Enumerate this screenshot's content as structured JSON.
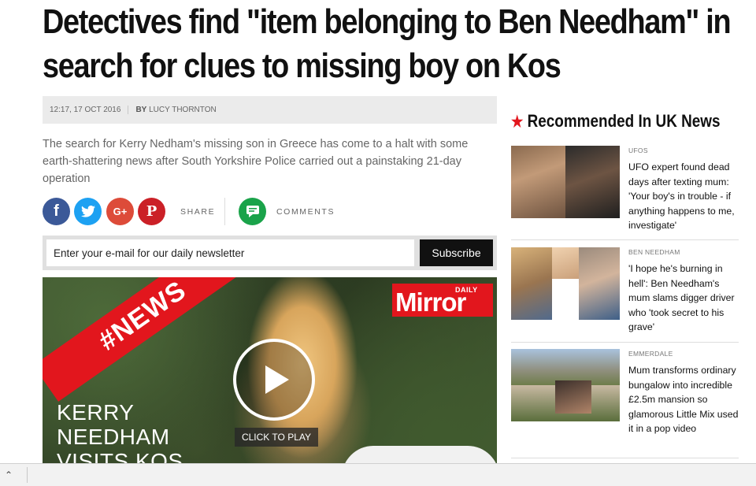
{
  "article": {
    "headline": "Detectives find \"item belonging to Ben Needham\" in search for clues to missing boy on Kos",
    "date": "12:17, 17 OCT 2016",
    "by_prefix": "BY",
    "author": "LUCY THORNTON",
    "standfirst": "The search for Kerry Nedham's missing son in Greece has come to a halt with some earth-shattering news after South Yorkshire Police carried out a painstaking 21-day operation"
  },
  "share": {
    "facebook_glyph": "f",
    "twitter_glyph": "t",
    "googleplus_glyph": "G+",
    "pinterest_glyph": "P",
    "share_label": "SHARE",
    "comments_label": "COMMENTS"
  },
  "newsletter": {
    "placeholder": "Enter your e-mail for our daily newsletter",
    "button": "Subscribe"
  },
  "video": {
    "ribbon": "#NEWS",
    "logo_daily": "DAILY",
    "logo_mirror": "Mirror",
    "caption_line1": "KERRY",
    "caption_line2": "NEEDHAM",
    "caption_line3": "VISITS KOS",
    "click_to_play": "CLICK TO PLAY"
  },
  "sidebar": {
    "title": "Recommended In UK News",
    "items": [
      {
        "category": "UFOS",
        "text": "UFO expert found dead days after texting mum: 'Your boy's in trouble - if anything happens to me, investigate'"
      },
      {
        "category": "BEN NEEDHAM",
        "text": "'I hope he's burning in hell': Ben Needham's mum slams digger driver who 'took secret to his grave'"
      },
      {
        "category": "EMMERDALE",
        "text": "Mum transforms ordinary bungalow into incredible £2.5m mansion so glamorous Little Mix used it in a pop video"
      }
    ]
  },
  "colors": {
    "accent_red": "#e2161d",
    "facebook": "#3b5998",
    "twitter": "#1da1f2",
    "googleplus": "#dd4b39",
    "pinterest": "#cb2027",
    "comments": "#1aa34a"
  }
}
